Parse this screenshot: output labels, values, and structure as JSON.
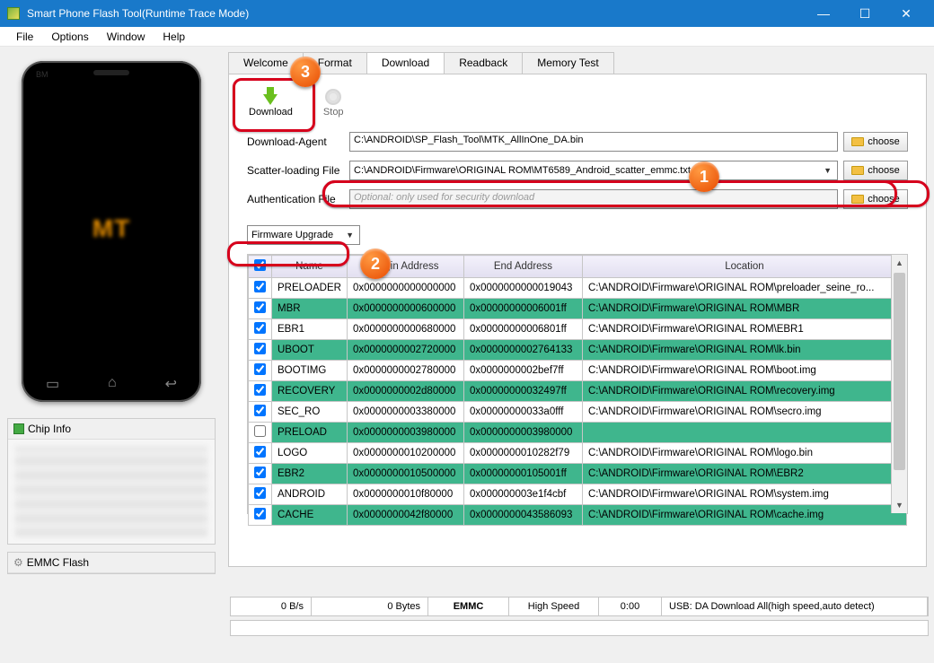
{
  "window": {
    "title": "Smart Phone Flash Tool(Runtime Trace Mode)"
  },
  "menu": [
    "File",
    "Options",
    "Window",
    "Help"
  ],
  "tabs": [
    "Welcome",
    "Format",
    "Download",
    "Readback",
    "Memory Test"
  ],
  "active_tab": 2,
  "toolbar": {
    "download": "Download",
    "stop": "Stop"
  },
  "files": {
    "da_label": "Download-Agent",
    "da_path": "C:\\ANDROID\\SP_Flash_Tool\\MTK_AllInOne_DA.bin",
    "scatter_label": "Scatter-loading File",
    "scatter_path": "C:\\ANDROID\\Firmware\\ORIGINAL ROM\\MT6589_Android_scatter_emmc.txt",
    "auth_label": "Authentication File",
    "auth_placeholder": "Optional: only used for security download",
    "choose": "choose"
  },
  "mode": "Firmware Upgrade",
  "table": {
    "headers": [
      "",
      "Name",
      "Begin Address",
      "End Address",
      "Location"
    ],
    "rows": [
      {
        "checked": true,
        "green": false,
        "name": "PRELOADER",
        "begin": "0x0000000000000000",
        "end": "0x0000000000019043",
        "loc": "C:\\ANDROID\\Firmware\\ORIGINAL ROM\\preloader_seine_ro..."
      },
      {
        "checked": true,
        "green": true,
        "name": "MBR",
        "begin": "0x0000000000600000",
        "end": "0x00000000006001ff",
        "loc": "C:\\ANDROID\\Firmware\\ORIGINAL ROM\\MBR"
      },
      {
        "checked": true,
        "green": false,
        "name": "EBR1",
        "begin": "0x0000000000680000",
        "end": "0x00000000006801ff",
        "loc": "C:\\ANDROID\\Firmware\\ORIGINAL ROM\\EBR1"
      },
      {
        "checked": true,
        "green": true,
        "name": "UBOOT",
        "begin": "0x0000000002720000",
        "end": "0x0000000002764133",
        "loc": "C:\\ANDROID\\Firmware\\ORIGINAL ROM\\lk.bin"
      },
      {
        "checked": true,
        "green": false,
        "name": "BOOTIMG",
        "begin": "0x0000000002780000",
        "end": "0x0000000002bef7ff",
        "loc": "C:\\ANDROID\\Firmware\\ORIGINAL ROM\\boot.img"
      },
      {
        "checked": true,
        "green": true,
        "name": "RECOVERY",
        "begin": "0x0000000002d80000",
        "end": "0x00000000032497ff",
        "loc": "C:\\ANDROID\\Firmware\\ORIGINAL ROM\\recovery.img"
      },
      {
        "checked": true,
        "green": false,
        "name": "SEC_RO",
        "begin": "0x0000000003380000",
        "end": "0x00000000033a0fff",
        "loc": "C:\\ANDROID\\Firmware\\ORIGINAL ROM\\secro.img"
      },
      {
        "checked": false,
        "green": true,
        "name": "PRELOAD",
        "begin": "0x0000000003980000",
        "end": "0x0000000003980000",
        "loc": ""
      },
      {
        "checked": true,
        "green": false,
        "name": "LOGO",
        "begin": "0x0000000010200000",
        "end": "0x0000000010282f79",
        "loc": "C:\\ANDROID\\Firmware\\ORIGINAL ROM\\logo.bin"
      },
      {
        "checked": true,
        "green": true,
        "name": "EBR2",
        "begin": "0x0000000010500000",
        "end": "0x00000000105001ff",
        "loc": "C:\\ANDROID\\Firmware\\ORIGINAL ROM\\EBR2"
      },
      {
        "checked": true,
        "green": false,
        "name": "ANDROID",
        "begin": "0x0000000010f80000",
        "end": "0x000000003e1f4cbf",
        "loc": "C:\\ANDROID\\Firmware\\ORIGINAL ROM\\system.img"
      },
      {
        "checked": true,
        "green": true,
        "name": "CACHE",
        "begin": "0x0000000042f80000",
        "end": "0x0000000043586093",
        "loc": "C:\\ANDROID\\Firmware\\ORIGINAL ROM\\cache.img"
      }
    ]
  },
  "phone": {
    "brand": "BM",
    "chip": "MT"
  },
  "sidebar": {
    "chip_info": "Chip Info",
    "emmc": "EMMC Flash"
  },
  "status": {
    "speed": "0 B/s",
    "bytes": "0 Bytes",
    "storage": "EMMC",
    "mode": "High Speed",
    "time": "0:00",
    "usb": "USB: DA Download All(high speed,auto detect)"
  },
  "badges": {
    "b1": "1",
    "b2": "2",
    "b3": "3"
  }
}
